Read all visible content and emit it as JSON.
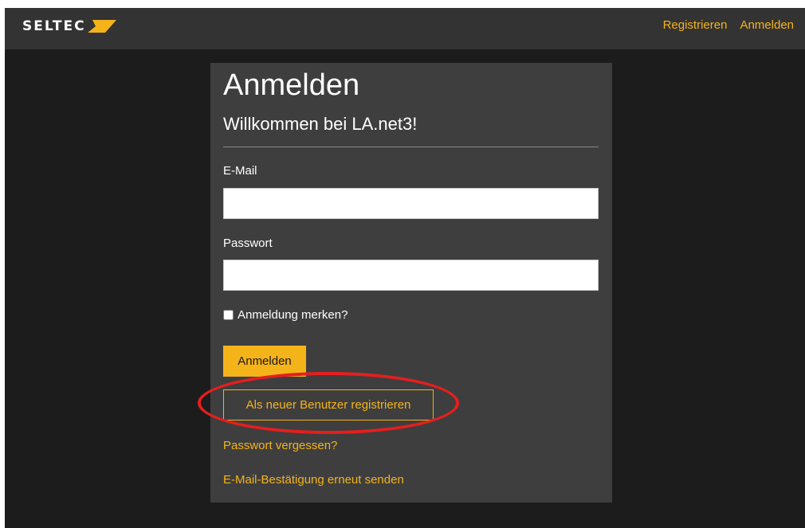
{
  "brand": {
    "name": "SELTEC"
  },
  "nav": {
    "register": "Registrieren",
    "login": "Anmelden"
  },
  "form": {
    "title": "Anmelden",
    "subtitle": "Willkommen bei LA.net3!",
    "email_label": "E-Mail",
    "email_value": "",
    "password_label": "Passwort",
    "password_value": "",
    "remember_label": "Anmeldung merken?",
    "remember_checked": false,
    "submit_label": "Anmelden",
    "register_label": "Als neuer Benutzer registrieren",
    "forgot_password": "Passwort vergessen?",
    "resend_confirmation": "E-Mail-Bestätigung erneut senden"
  },
  "colors": {
    "accent": "#f5b31a",
    "navbar": "#333333",
    "page_background": "#1c1c1c",
    "panel": "#3e3e3e",
    "annotation": "#e61e1e"
  },
  "icons": {
    "logo_mark": "yellow-slash-logo"
  }
}
